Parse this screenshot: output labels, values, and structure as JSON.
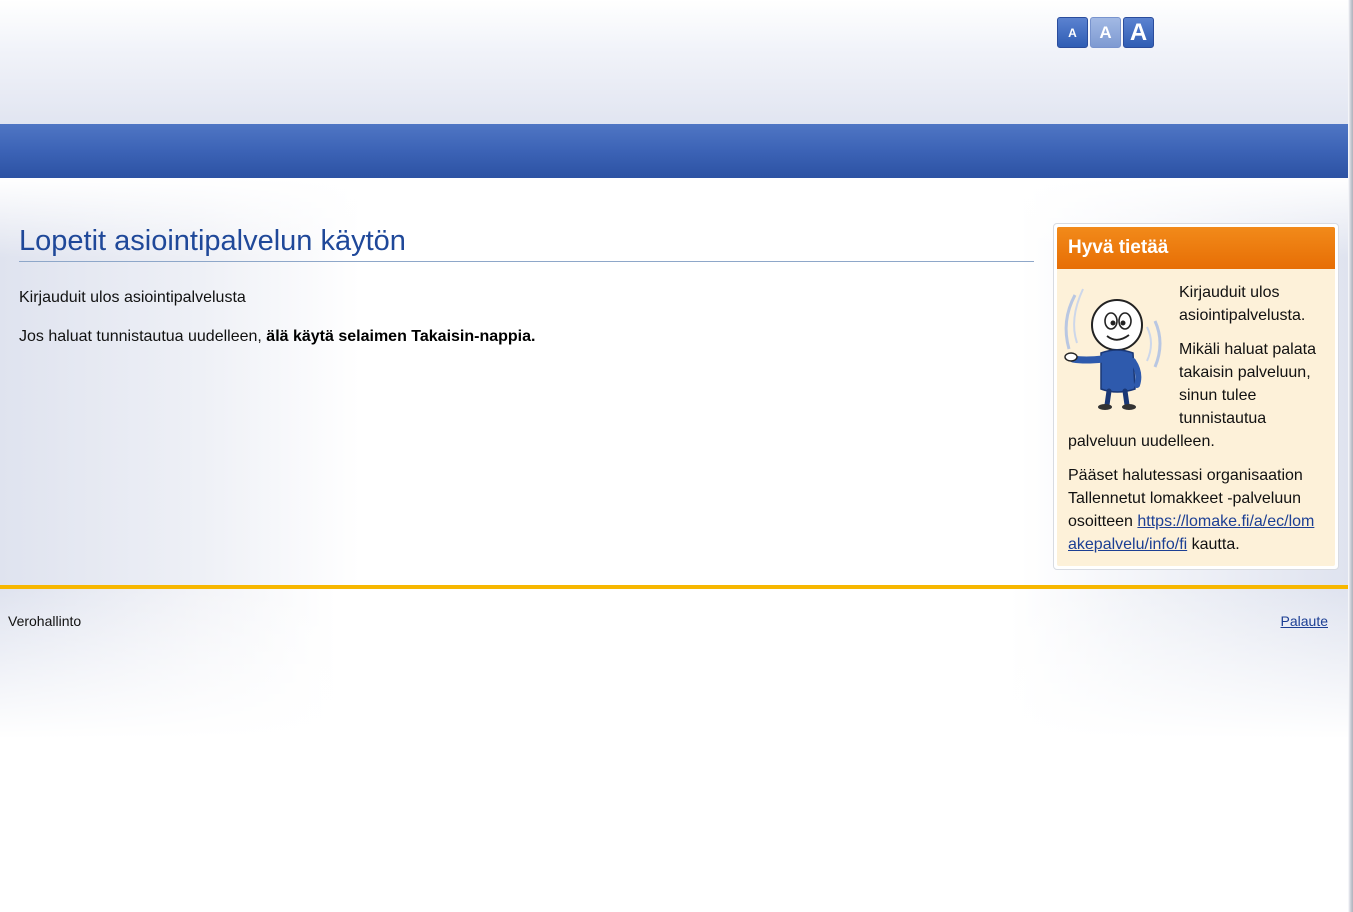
{
  "font_size_controls": {
    "small_label": "A",
    "medium_label": "A",
    "large_label": "A"
  },
  "main": {
    "title": "Lopetit asiointipalvelun käytön",
    "logout_message": "Kirjauduit ulos asiointipalvelusta",
    "reauth_prefix": "Jos haluat tunnistautua uudelleen, ",
    "reauth_bold": "älä käytä selaimen Takaisin-nappia."
  },
  "info_box": {
    "header": "Hyvä tietää",
    "para1": "Kirjauduit ulos asiointipalvelusta.",
    "para2": "Mikäli haluat palata takaisin palveluun, sinun tulee tunnistautua palveluun uudelleen.",
    "para3_prefix": "Pääset halutessasi organisaation Tallennetut lomakkeet -palveluun osoitteen ",
    "para3_link": "https://lomake.fi/a/ec/lomakepalvelu/info/fi",
    "para3_suffix": " kautta."
  },
  "footer": {
    "org_name": "Verohallinto",
    "feedback_link": "Palaute"
  },
  "colors": {
    "brand_blue": "#2c52a3",
    "title_blue": "#1f4899",
    "info_orange": "#e76e05",
    "info_bg": "#fdf1d9",
    "divider_yellow": "#f7b700",
    "link_blue": "#1c3f94"
  }
}
